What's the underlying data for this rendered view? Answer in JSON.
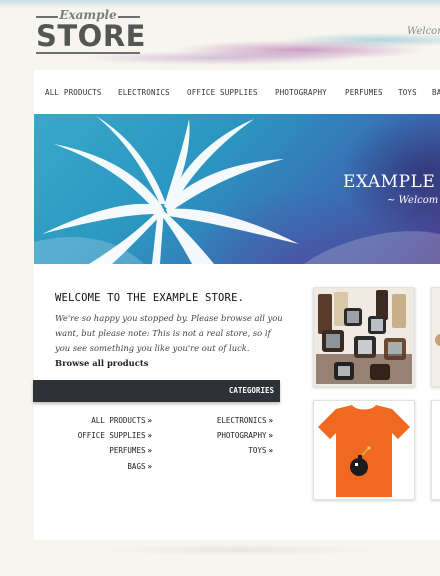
{
  "logo": {
    "small": "Example",
    "big": "STORE"
  },
  "header": {
    "welcome": "Welcom"
  },
  "nav": {
    "items": [
      {
        "label": "ALL PRODUCTS"
      },
      {
        "label": "ELECTRONICS"
      },
      {
        "label": "OFFICE SUPPLIES"
      },
      {
        "label": "PHOTOGRAPHY"
      },
      {
        "label": "PERFUMES"
      },
      {
        "label": "TOYS"
      },
      {
        "label": "BA"
      }
    ]
  },
  "hero": {
    "title": "EXAMPLE S",
    "subtitle": "~ Welcom"
  },
  "main": {
    "title": "WELCOME TO THE EXAMPLE STORE.",
    "intro": "We're so happy you stopped by. Please browse all you want, but please note: This is not a real store, so if you see something you like you're out of luck.",
    "intro_link": "Browse all products"
  },
  "categories": {
    "header": "CATEGORIES",
    "left": [
      {
        "label": "ALL PRODUCTS"
      },
      {
        "label": "OFFICE SUPPLIES"
      },
      {
        "label": "PERFUMES"
      },
      {
        "label": "BAGS"
      }
    ],
    "right": [
      {
        "label": "ELECTRONICS"
      },
      {
        "label": "PHOTOGRAPHY"
      },
      {
        "label": "TOYS"
      }
    ],
    "arrow": "»"
  },
  "colors": {
    "background": "#f6f5ef",
    "category_bar": "#2e3236",
    "hero_blue": "#2b95c0",
    "accent_purple": "#a856a0",
    "tshirt_orange": "#ef6a1f"
  }
}
